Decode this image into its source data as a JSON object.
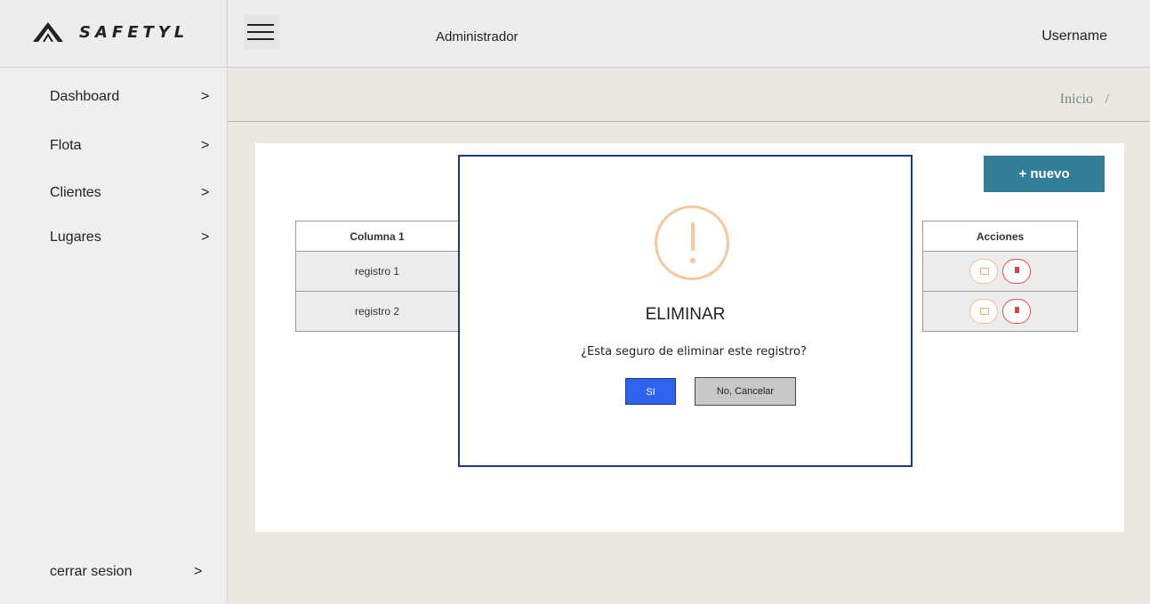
{
  "brand": {
    "name": "SAFETYL"
  },
  "header": {
    "role": "Administrador",
    "username": "Username"
  },
  "sidebar": {
    "items": [
      {
        "label": "Dashboard",
        "arrow": ">"
      },
      {
        "label": "Flota",
        "arrow": ">"
      },
      {
        "label": "Clientes",
        "arrow": ">"
      },
      {
        "label": "Lugares",
        "arrow": ">"
      }
    ],
    "logout": {
      "label": "cerrar sesion",
      "arrow": ">"
    }
  },
  "breadcrumb": {
    "home": "Inicio",
    "separator": "/"
  },
  "main": {
    "new_button": "+ nuevo",
    "table": {
      "headers": [
        "Columna 1",
        "Acciones"
      ],
      "rows": [
        {
          "cells": [
            "registro 1"
          ]
        },
        {
          "cells": [
            "registro 2"
          ]
        }
      ]
    }
  },
  "modal": {
    "icon": "warning-icon",
    "title": "ELIMINAR",
    "message": "¿Esta seguro de eliminar este registro?",
    "confirm_label": "SI",
    "cancel_label": "No, Cancelar"
  },
  "colors": {
    "primary": "#337e96",
    "confirm": "#2f63ee",
    "warning": "#f5c89c",
    "delete": "#ea3a3a"
  }
}
